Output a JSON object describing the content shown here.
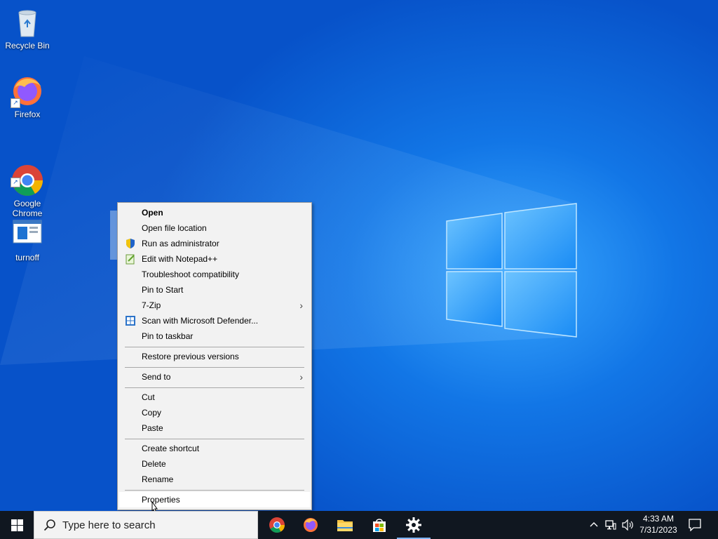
{
  "desktop": {
    "icons": [
      {
        "label": "Recycle Bin"
      },
      {
        "label": "Firefox"
      },
      {
        "label": "Google\nChrome"
      },
      {
        "label": "turnoff"
      }
    ]
  },
  "context_menu": {
    "items": [
      {
        "label": "Open"
      },
      {
        "label": "Open file location"
      },
      {
        "label": "Run as administrator"
      },
      {
        "label": "Edit with Notepad++"
      },
      {
        "label": "Troubleshoot compatibility"
      },
      {
        "label": "Pin to Start"
      },
      {
        "label": "7-Zip"
      },
      {
        "label": "Scan with Microsoft Defender..."
      },
      {
        "label": "Pin to taskbar"
      },
      {
        "label": "Restore previous versions"
      },
      {
        "label": "Send to"
      },
      {
        "label": "Cut"
      },
      {
        "label": "Copy"
      },
      {
        "label": "Paste"
      },
      {
        "label": "Create shortcut"
      },
      {
        "label": "Delete"
      },
      {
        "label": "Rename"
      },
      {
        "label": "Properties"
      }
    ]
  },
  "taskbar": {
    "search_placeholder": "Type here to search",
    "apps": [
      "chrome-icon",
      "firefox-icon",
      "file-explorer-icon",
      "microsoft-store-icon",
      "settings-icon"
    ],
    "clock_time": "4:33 AM",
    "clock_date": "7/31/2023"
  },
  "colors": {
    "accent": "#0a5fd8",
    "taskbar": "#101720",
    "menu_bg": "#f2f2f2"
  }
}
